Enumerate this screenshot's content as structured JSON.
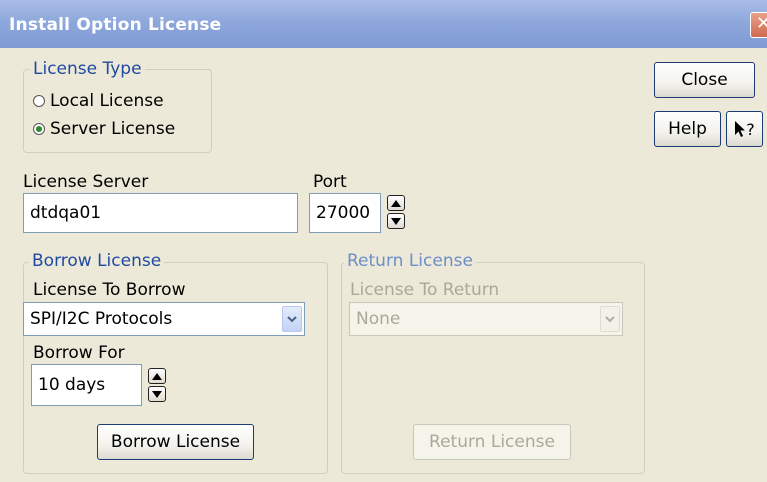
{
  "window": {
    "title": "Install Option License",
    "close_glyph": "✕"
  },
  "license_type": {
    "legend": "License Type",
    "options": [
      {
        "label": "Local License",
        "checked": false
      },
      {
        "label": "Server License",
        "checked": true
      }
    ]
  },
  "buttons": {
    "close": "Close",
    "help": "Help",
    "whats_this": "?",
    "borrow_license": "Borrow License",
    "return_license": "Return License"
  },
  "server": {
    "label": "License Server",
    "value": "dtdqa01",
    "port_label": "Port",
    "port_value": "27000"
  },
  "borrow": {
    "legend": "Borrow License",
    "to_borrow_label": "License To Borrow",
    "to_borrow_value": "SPI/I2C Protocols",
    "borrow_for_label": "Borrow For",
    "borrow_for_value": "10 days"
  },
  "return": {
    "legend": "Return License",
    "to_return_label": "License To Return",
    "to_return_value": "None"
  },
  "icons": [
    "close-icon",
    "pointer-question-icon",
    "spin-up-icon",
    "spin-down-icon",
    "chevron-down-icon"
  ]
}
